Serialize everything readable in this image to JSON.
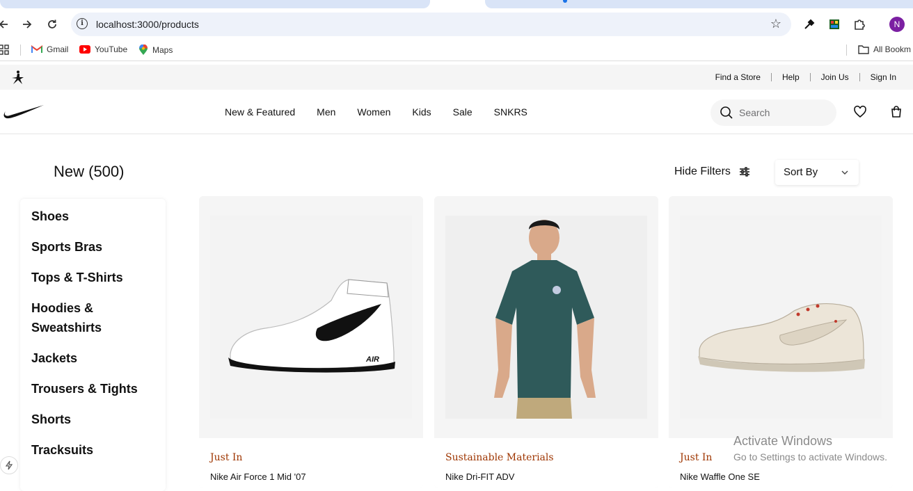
{
  "browser": {
    "url": "localhost:3000/products",
    "profile_initial": "N",
    "bookmarks": [
      {
        "label": "Gmail"
      },
      {
        "label": "YouTube"
      },
      {
        "label": "Maps"
      }
    ],
    "all_bookmarks_label": "All Bookm"
  },
  "utility_nav": {
    "links": [
      "Find a Store",
      "Help",
      "Join Us",
      "Sign In"
    ]
  },
  "main_nav": {
    "items": [
      "New & Featured",
      "Men",
      "Women",
      "Kids",
      "Sale",
      "SNKRS"
    ],
    "search_placeholder": "Search"
  },
  "listing": {
    "title": "New (500)",
    "hide_filters_label": "Hide Filters",
    "sort_label": "Sort By"
  },
  "sidebar": {
    "categories": [
      "Shoes",
      "Sports Bras",
      "Tops & T-Shirts",
      "Hoodies &",
      "Sweatshirts",
      "Jackets",
      "Trousers & Tights",
      "Shorts",
      "Tracksuits"
    ]
  },
  "products": [
    {
      "tag": "Just In",
      "name": "Nike Air Force 1 Mid '07"
    },
    {
      "tag": "Sustainable Materials",
      "name": "Nike Dri-FIT ADV"
    },
    {
      "tag": "Just In",
      "name": "Nike Waffle One SE"
    }
  ],
  "watermark": {
    "line1": "Activate Windows",
    "line2": "Go to Settings to activate Windows."
  },
  "colors": {
    "tag": "#9e3500",
    "omnibox": "#eef2fa",
    "card_bg": "#f5f5f5"
  }
}
